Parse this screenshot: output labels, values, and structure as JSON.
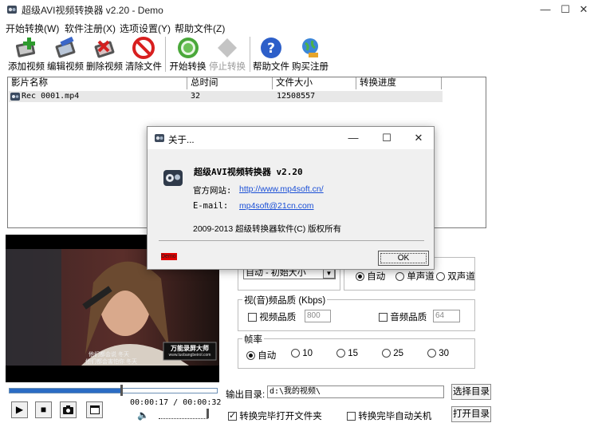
{
  "window": {
    "title": "超级AVI视频转换器 v2.20 - Demo",
    "controls": {
      "minimize": "—",
      "maximize": "☐",
      "close": "✕"
    }
  },
  "menu": [
    "开始转换(W)",
    "软件注册(X)",
    "选项设置(Y)",
    "帮助文件(Z)"
  ],
  "toolbar": {
    "add": "添加视频",
    "edit": "编辑视频",
    "delete": "删除视频",
    "clear": "清除文件",
    "start": "开始转换",
    "stop": "停止转换",
    "help": "帮助文件",
    "buy": "购买注册"
  },
  "file_list": {
    "columns": [
      "影片名称",
      "总时间",
      "文件大小",
      "转换进度"
    ],
    "rows": [
      {
        "name": "Rec 0001.mp4",
        "duration": "32",
        "size": "12508557",
        "progress": ""
      }
    ]
  },
  "preview": {
    "watermark_title": "万能录屏大师",
    "watermark_url": "www.luobangbeirol.com",
    "subtitle": "他们都会说 冬天",
    "subtitle2": "他们都会害怕你 冬天"
  },
  "player": {
    "time": "00:00:17 / 00:00:32",
    "seek_progress": 0.54,
    "volume": 1.0,
    "play_icon": "▶",
    "stop_icon": "■",
    "snapshot_icon": "camera-icon",
    "fullscreen_icon": "window-icon",
    "volume_icon": "speaker-icon"
  },
  "settings": {
    "size_select": "自动 - 初始大小",
    "channel": {
      "auto": "自动",
      "mono": "单声道",
      "stereo": "双声道",
      "selected": "auto"
    },
    "quality": {
      "title": "视(音)频品质 (Kbps)",
      "video_label": "视频品质",
      "video_value": "800",
      "audio_label": "音频品质",
      "audio_value": "64"
    },
    "framerate": {
      "title": "帧率",
      "options": [
        "自动",
        "10",
        "15",
        "25",
        "30"
      ],
      "selected": "自动"
    },
    "output": {
      "label": "输出目录:",
      "path": "d:\\我的视频\\",
      "choose_button": "选择目录",
      "open_button": "打开目录",
      "open_after": "转换完毕打开文件夹",
      "open_after_checked": true,
      "shutdown_after": "转换完毕自动关机",
      "shutdown_after_checked": false
    }
  },
  "about_dialog": {
    "title": "关于...",
    "app_name": "超级AVI视频转换器 v2.20",
    "website_label": "官方网站:",
    "website_url": "http://www.mp4soft.cn/",
    "email_label": "E-mail:",
    "email": "mp4soft@21cn.com",
    "copyright": "2009-2013 超级转换器软件(C) 版权所有",
    "demo_badge": "Demo",
    "ok_button": "OK"
  }
}
